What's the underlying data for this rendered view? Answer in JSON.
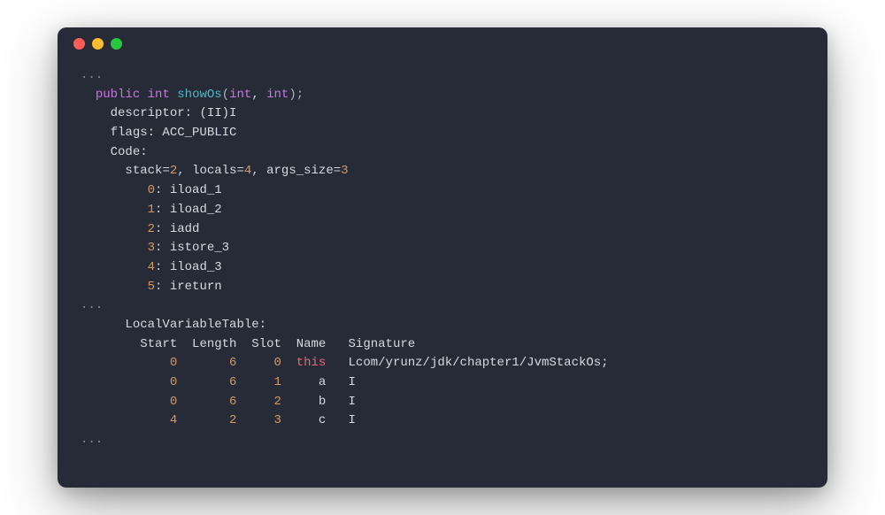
{
  "ellipsis": "...",
  "sig": {
    "public": "public",
    "int": "int",
    "name": "showOs",
    "open": "(",
    "p1": "int",
    "comma": ", ",
    "p2": "int",
    "close": ");"
  },
  "descriptor_label": "descriptor: ",
  "descriptor_value": "(II)I",
  "flags_label": "flags: ",
  "flags_value": "ACC_PUBLIC",
  "code_label": "Code:",
  "stack": {
    "pre": "stack",
    "eq1": "=",
    "v1": "2",
    "sep1": ", ",
    "locals": "locals",
    "eq2": "=",
    "v2": "4",
    "sep2": ", ",
    "args": "args_size",
    "eq3": "=",
    "v3": "3"
  },
  "instructions": [
    {
      "idx": "0",
      "op": "iload_1"
    },
    {
      "idx": "1",
      "op": "iload_2"
    },
    {
      "idx": "2",
      "op": "iadd"
    },
    {
      "idx": "3",
      "op": "istore_3"
    },
    {
      "idx": "4",
      "op": "iload_3"
    },
    {
      "idx": "5",
      "op": "ireturn"
    }
  ],
  "lvt_label": "LocalVariableTable:",
  "lvt_header": {
    "start": "Start",
    "length": "Length",
    "slot": "Slot",
    "name": "Name",
    "signature": "Signature"
  },
  "lvt_rows": [
    {
      "start": "0",
      "length": "6",
      "slot": "0",
      "name": "this",
      "name_class": "this",
      "signature": "Lcom/yrunz/jdk/chapter1/JvmStackOs;"
    },
    {
      "start": "0",
      "length": "6",
      "slot": "1",
      "name": "a",
      "name_class": "word",
      "signature": "I"
    },
    {
      "start": "0",
      "length": "6",
      "slot": "2",
      "name": "b",
      "name_class": "word",
      "signature": "I"
    },
    {
      "start": "4",
      "length": "2",
      "slot": "3",
      "name": "c",
      "name_class": "word",
      "signature": "I"
    }
  ]
}
